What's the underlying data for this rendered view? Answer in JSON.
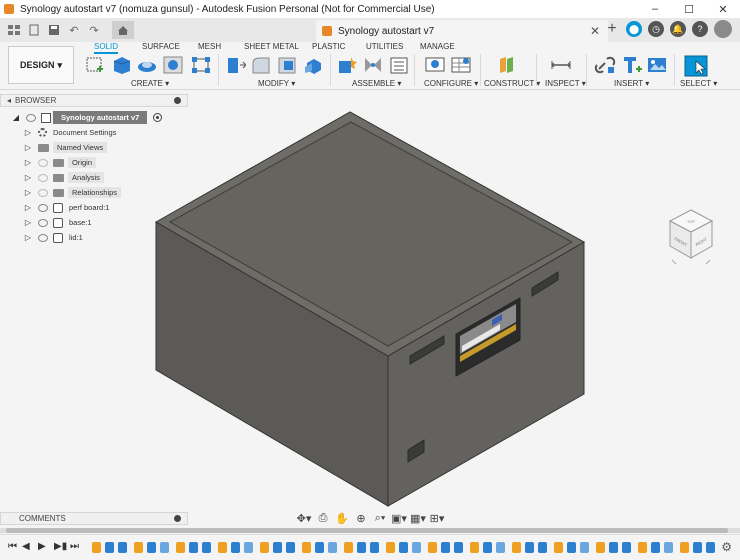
{
  "window": {
    "title": "Synology autostart v7 (nomuza gunsul) - Autodesk Fusion Personal (Not for Commercial Use)",
    "minimize": "–",
    "maximize": "☐",
    "close": "✕"
  },
  "appbar": {
    "doc_tab_title": "Synology autostart v7",
    "doc_tab_close": "✕",
    "add_tab": "+"
  },
  "ribbon": {
    "workspace_label": "DESIGN",
    "tabs": [
      "SOLID",
      "SURFACE",
      "MESH",
      "SHEET METAL",
      "PLASTIC",
      "UTILITIES",
      "MANAGE"
    ],
    "groups": [
      "CREATE ▾",
      "MODIFY ▾",
      "ASSEMBLE ▾",
      "CONFIGURE ▾",
      "CONSTRUCT ▾",
      "INSPECT ▾",
      "INSERT ▾",
      "SELECT ▾"
    ]
  },
  "browser": {
    "header": "BROWSER",
    "root": "Synology autostart v7",
    "items": [
      {
        "label": "Document Settings",
        "icon": "gear-icon"
      },
      {
        "label": "Named Views",
        "icon": "folder-icon"
      },
      {
        "label": "Origin",
        "icon": "folder-icon"
      },
      {
        "label": "Analysis",
        "icon": "folder-icon"
      },
      {
        "label": "Relationships",
        "icon": "folder-icon"
      },
      {
        "label": "perf board:1",
        "icon": "component-icon"
      },
      {
        "label": "base:1",
        "icon": "component-icon"
      },
      {
        "label": "lid:1",
        "icon": "component-icon"
      }
    ]
  },
  "viewcube": {
    "front": "FRONT",
    "right": "RIGHT",
    "top": "TOP"
  },
  "comments": {
    "label": "COMMENTS"
  },
  "colors": {
    "accent": "#0696d7",
    "body_gray": "#5f5e5b",
    "top_gray": "#6f6d68"
  }
}
